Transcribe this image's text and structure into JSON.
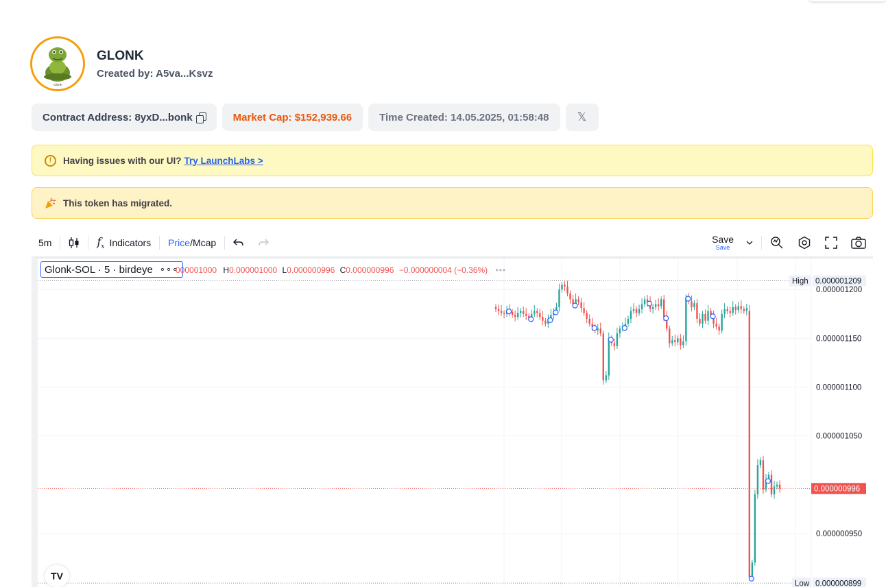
{
  "token": {
    "name": "GLONK",
    "creator": "Created by: A5va...Ksvz",
    "avatar_caption": "Glonk"
  },
  "chips": {
    "contract": "Contract Address: 8yxD...bonk",
    "market_cap": "Market Cap: $152,939.66",
    "time_created": "Time Created: 14.05.2025, 01:58:48",
    "x_icon": "𝕏"
  },
  "banners": {
    "issue_text": "Having issues with our UI?",
    "issue_link": "Try LaunchLabs >",
    "migrated_text": "This token has migrated."
  },
  "toolbar": {
    "interval": "5m",
    "indicators": "Indicators",
    "price": "Price",
    "slash": "/",
    "mcap": "Mcap",
    "save": "Save",
    "save_sub": "Save"
  },
  "legend": {
    "symbol": "Glonk-SOL · 5 · birdeye",
    "dots": "∘∘∘",
    "o_val": "000001000",
    "h_label": "H",
    "h_val": "0.000001000",
    "l_label": "L",
    "l_val": "0.000000996",
    "c_label": "C",
    "c_val": "0.000000996",
    "change": "−0.000000004 (−0.36%)"
  },
  "chart_data": {
    "type": "candlestick",
    "y_ticks": [
      "0.000001200",
      "0.000001150",
      "0.000001100",
      "0.000001050",
      "0.000000950"
    ],
    "y_tick_values": [
      1.2,
      1.15,
      1.1,
      1.05,
      0.95
    ],
    "high_label": "High",
    "high_value": "0.000001209",
    "low_label": "Low",
    "low_value": "0.000000899",
    "last_price": "0.000000996",
    "ylim": [
      0.895,
      1.229
    ],
    "series_close": [
      1.18,
      1.178,
      1.176,
      1.175,
      1.179,
      1.177,
      1.174,
      1.172,
      1.176,
      1.178,
      1.175,
      1.173,
      1.171,
      1.175,
      1.178,
      1.176,
      1.172,
      1.168,
      1.165,
      1.17,
      1.174,
      1.178,
      1.182,
      1.2,
      1.205,
      1.203,
      1.196,
      1.19,
      1.185,
      1.19,
      1.187,
      1.181,
      1.176,
      1.17,
      1.165,
      1.162,
      1.158,
      1.16,
      1.155,
      1.107,
      1.112,
      1.15,
      1.145,
      1.142,
      1.155,
      1.16,
      1.162,
      1.165,
      1.17,
      1.178,
      1.18,
      1.176,
      1.18,
      1.185,
      1.19,
      1.187,
      1.18,
      1.182,
      1.185,
      1.183,
      1.19,
      1.172,
      1.16,
      1.145,
      1.148,
      1.146,
      1.15,
      1.143,
      1.147,
      1.192,
      1.188,
      1.182,
      1.186,
      1.17,
      1.165,
      1.175,
      1.168,
      1.178,
      1.174,
      1.165,
      1.162,
      1.158,
      1.175,
      1.18,
      1.178,
      1.176,
      1.182,
      1.179,
      1.183,
      1.18,
      1.178,
      1.181,
      0.905,
      0.92,
      0.99,
      1.02,
      1.025,
      0.995,
      1.005,
      1.01,
      0.99,
      0.998,
      1.0,
      0.996
    ],
    "markers_idx": [
      4,
      12,
      19,
      21,
      28,
      35,
      41,
      46,
      55,
      61,
      69,
      78
    ],
    "markers_idx2": [
      92,
      98
    ]
  }
}
